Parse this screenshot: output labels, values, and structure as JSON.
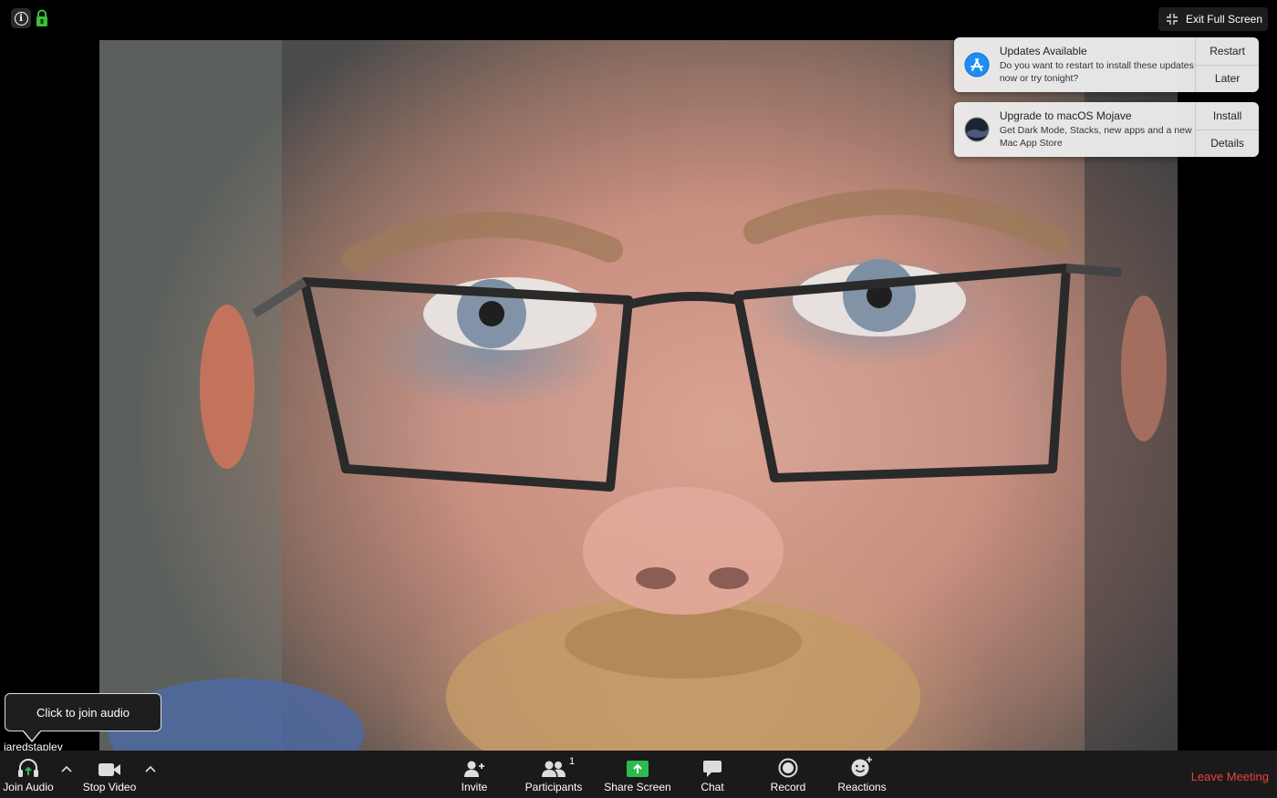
{
  "top_bar": {
    "exit_fullscreen_label": "Exit Full Screen"
  },
  "video": {
    "participant_name": "jaredstapley"
  },
  "notifications": [
    {
      "icon": "app-store-icon",
      "title": "Updates Available",
      "text": "Do you want to restart to install these updates now or try tonight?",
      "actions": [
        "Restart",
        "Later"
      ]
    },
    {
      "icon": "macos-mojave-icon",
      "title": "Upgrade to macOS Mojave",
      "text": "Get Dark Mode, Stacks, new apps and a new Mac App Store",
      "actions": [
        "Install",
        "Details"
      ]
    }
  ],
  "tooltip": {
    "text": "Click to join audio"
  },
  "toolbar": {
    "join_audio": "Join Audio",
    "stop_video": "Stop Video",
    "invite": "Invite",
    "participants": "Participants",
    "participants_count": "1",
    "share_screen": "Share Screen",
    "chat": "Chat",
    "record": "Record",
    "reactions": "Reactions",
    "leave_meeting": "Leave Meeting"
  },
  "colors": {
    "share_green": "#2dbb4d",
    "leave_red": "#e8433b",
    "lock_green": "#3bbf3b"
  }
}
